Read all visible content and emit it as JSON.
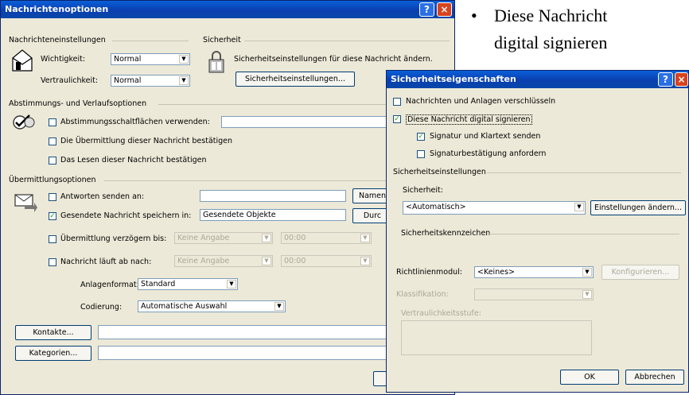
{
  "nach": {
    "title": "Nachrichtenoptionen",
    "help": "?",
    "close": "×",
    "settings_group": "Nachrichteneinstellungen",
    "importance_label": "Wichtigkeit:",
    "importance_value": "Normal",
    "sensitivity_label": "Vertraulichkeit:",
    "sensitivity_value": "Normal",
    "security_group": "Sicherheit",
    "security_text": "Sicherheitseinstellungen für diese Nachricht ändern.",
    "security_button": "Sicherheitseinstellungen...",
    "voting_group": "Abstimmungs- und Verlaufsoptionen",
    "voting_check": "Abstimmungsschaltflächen verwenden:",
    "delivery_receipt": "Die Übermittlung dieser Nachricht bestätigen",
    "read_receipt": "Das Lesen dieser Nachricht bestätigen",
    "delivery_group": "Übermittlungsoptionen",
    "reply_to": "Antworten senden an:",
    "names_button": "Namen",
    "save_sent": "Gesendete Nachricht speichern in:",
    "save_sent_value": "Gesendete Objekte",
    "browse_button": "Durc",
    "delay": "Übermittlung verzögern bis:",
    "delay_date": "Keine Angabe",
    "delay_time": "00:00",
    "expires": "Nachricht läuft ab nach:",
    "expires_date": "Keine Angabe",
    "expires_time": "00:00",
    "attach_format_label": "Anlagenformat:",
    "attach_format_value": "Standard",
    "encoding_label": "Codierung:",
    "encoding_value": "Automatische Auswahl",
    "contacts_button": "Kontakte...",
    "categories_button": "Kategorien..."
  },
  "sich": {
    "title": "Sicherheitseigenschaften",
    "help": "?",
    "close": "×",
    "encrypt": "Nachrichten und Anlagen verschlüsseln",
    "sign": "Diese Nachricht digital signieren",
    "cleartext": "Signatur und Klartext senden",
    "request_receipt": "Signaturbestätigung anfordern",
    "settings_group": "Sicherheitseinstellungen",
    "security_label": "Sicherheit:",
    "security_value": "<Automatisch>",
    "change_button": "Einstellungen ändern...",
    "labels_group": "Sicherheitskennzeichen",
    "policy_label": "Richtlinienmodul:",
    "policy_value": "<Keines>",
    "configure_button": "Konfigurieren...",
    "classification_label": "Klassifikation:",
    "privacy_label": "Vertraulichkeitsstufe:",
    "ok_button": "OK",
    "cancel_button": "Abbrechen"
  },
  "slide": {
    "bullet": "•",
    "line1": "Diese Nachricht",
    "line2": "digital signieren"
  }
}
